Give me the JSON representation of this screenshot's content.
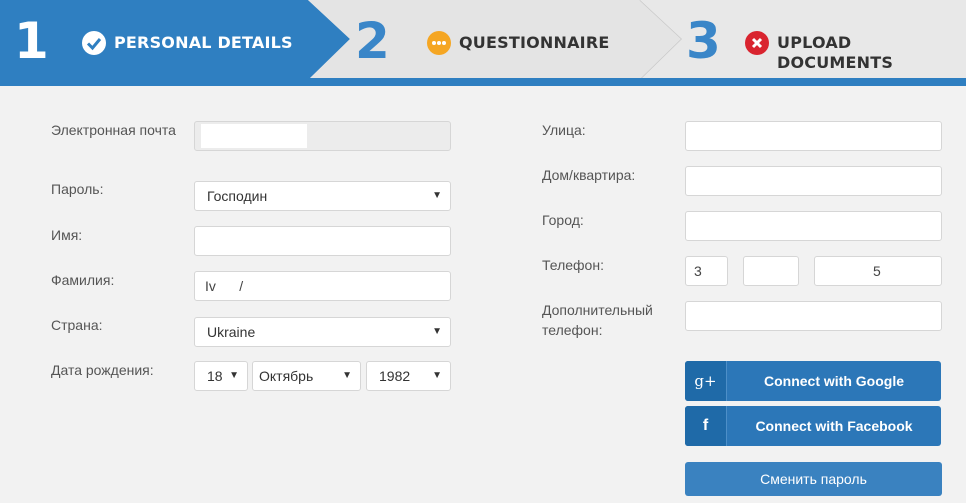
{
  "steps": [
    {
      "number": "1",
      "label": "PERSONAL DETAILS",
      "status_icon": "check-icon",
      "active": true
    },
    {
      "number": "2",
      "label": "QUESTIONNAIRE",
      "status_icon": "ellipsis-icon",
      "active": false
    },
    {
      "number": "3",
      "label": "UPLOAD DOCUMENTS",
      "status_icon": "error-x-icon",
      "active": false
    }
  ],
  "colors": {
    "active_step": "#2f7fc1",
    "number_inactive": "#3a86c8",
    "pending": "#f5a623",
    "error": "#d9242f",
    "button": "#2c77b8"
  },
  "form_left": {
    "email": {
      "label": "Электронная почта",
      "value": ""
    },
    "password": {
      "label": "Пароль:",
      "value": "Господин"
    },
    "first_name": {
      "label": "Имя:",
      "value": ""
    },
    "last_name": {
      "label": "Фамилия:",
      "value": "Iv      /"
    },
    "country": {
      "label": "Страна:",
      "value": "Ukraine"
    },
    "birth_date": {
      "label": "Дата рождения:",
      "day": "18",
      "month": "Октябрь",
      "year": "1982"
    }
  },
  "form_right": {
    "street": {
      "label": "Улица:",
      "value": ""
    },
    "house": {
      "label": "Дом/квартира:",
      "value": ""
    },
    "city": {
      "label": "Город:",
      "value": ""
    },
    "phone": {
      "label": "Телефон:",
      "code": "3",
      "part2": "",
      "part3": "5"
    },
    "phone2": {
      "label": "Дополнительный телефон:",
      "value": ""
    }
  },
  "buttons": {
    "google": {
      "label": "Connect with Google",
      "icon_glyph": "g+"
    },
    "facebook": {
      "label": "Connect with Facebook",
      "icon_glyph": "f"
    },
    "change_password": {
      "label": "Сменить пароль"
    }
  }
}
